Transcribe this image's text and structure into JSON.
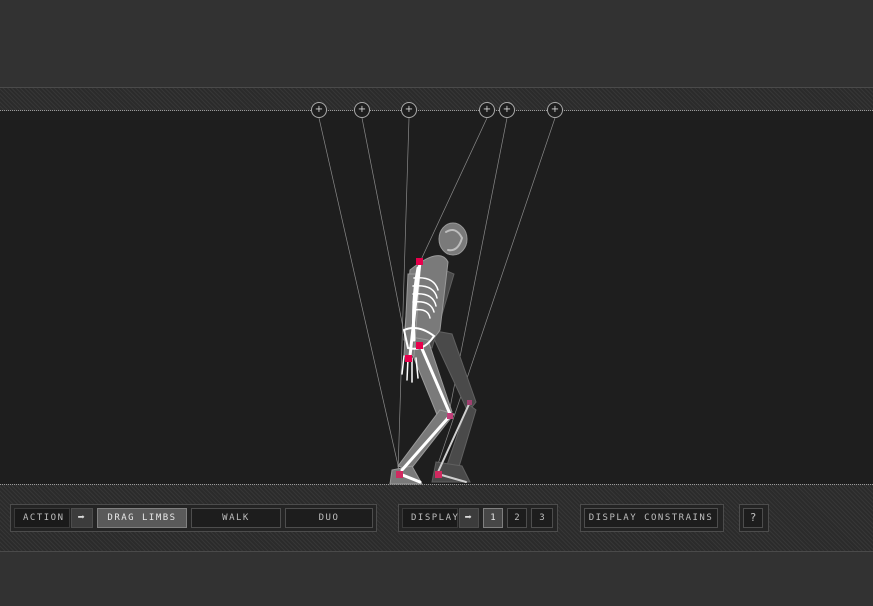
{
  "toolbar": {
    "action_label": "ACTION",
    "action_arrow": "➡",
    "modes": [
      {
        "label": "DRAG LIMBS",
        "active": true
      },
      {
        "label": "WALK",
        "active": false
      },
      {
        "label": "DUO",
        "active": false
      }
    ],
    "display_label": "DISPLAY",
    "display_arrow": "➡",
    "display_options": [
      {
        "label": "1",
        "active": true
      },
      {
        "label": "2",
        "active": false
      },
      {
        "label": "3",
        "active": false
      }
    ],
    "constrains_label": "DISPLAY CONSTRAINS",
    "help_label": "?"
  },
  "handles": [
    {
      "label": "+"
    },
    {
      "label": "+"
    },
    {
      "label": "+"
    },
    {
      "label": "+"
    },
    {
      "label": "+"
    },
    {
      "label": "+"
    }
  ],
  "colors": {
    "background": "#323232",
    "stage": "#1e1e1e",
    "joint": "#e8004c",
    "bone": "#ffffff"
  }
}
